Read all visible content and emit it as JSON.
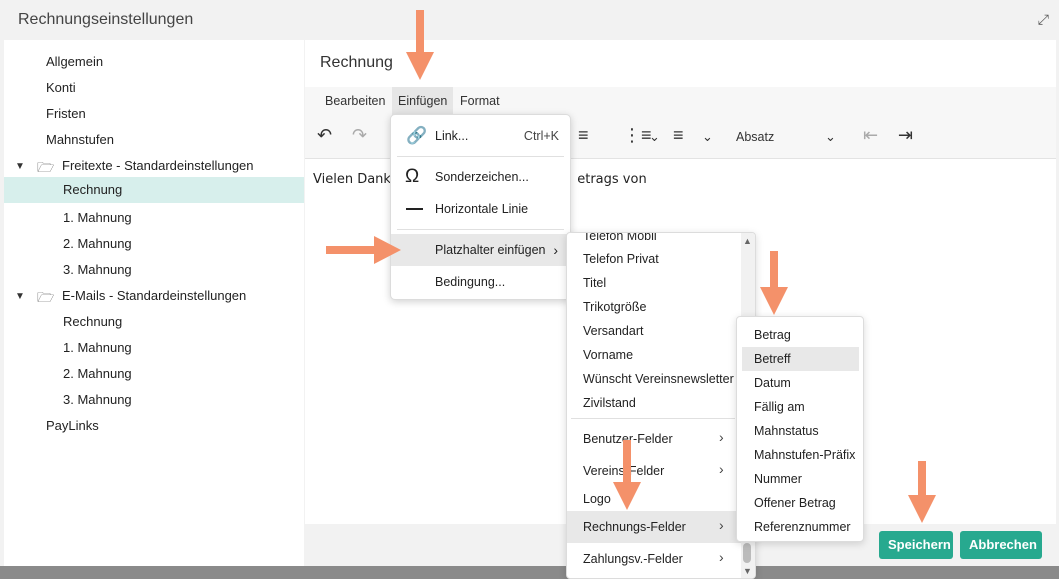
{
  "window": {
    "title": "Rechnungseinstellungen"
  },
  "sidebar": {
    "items": [
      {
        "label": "Allgemein"
      },
      {
        "label": "Konti"
      },
      {
        "label": "Fristen"
      },
      {
        "label": "Mahnstufen"
      },
      {
        "label": "Freitexte - Standardeinstellungen"
      },
      {
        "label": "Rechnung"
      },
      {
        "label": "1. Mahnung"
      },
      {
        "label": "2. Mahnung"
      },
      {
        "label": "3. Mahnung"
      },
      {
        "label": "E-Mails - Standardeinstellungen"
      },
      {
        "label": "Rechnung"
      },
      {
        "label": "1. Mahnung"
      },
      {
        "label": "2. Mahnung"
      },
      {
        "label": "3. Mahnung"
      },
      {
        "label": "PayLinks"
      }
    ]
  },
  "editor": {
    "title": "Rechnung",
    "menus": [
      "Bearbeiten",
      "Einfügen",
      "Format"
    ],
    "block_format": "Absatz",
    "text_left": "Vielen Dank",
    "text_right": "etrags von"
  },
  "insert_menu": {
    "link": {
      "label": "Link...",
      "shortcut": "Ctrl+K"
    },
    "special_chars": "Sonderzeichen...",
    "horizontal_line": "Horizontale Linie",
    "placeholder": "Platzhalter einfügen",
    "condition": "Bedingung..."
  },
  "placeholder_menu": {
    "items": [
      "Telefon Mobil",
      "Telefon Privat",
      "Titel",
      "Trikotgröße",
      "Versandart",
      "Vorname",
      "Wünscht Vereinsnewsletter",
      "Zivilstand"
    ],
    "groups": [
      "Benutzer-Felder",
      "Vereins-Felder",
      "Logo",
      "Rechnungs-Felder",
      "Zahlungsv.-Felder"
    ]
  },
  "invoice_fields": {
    "items": [
      "Betrag",
      "Betreff",
      "Datum",
      "Fällig am",
      "Mahnstatus",
      "Mahnstufen-Präfix",
      "Nummer",
      "Offener Betrag",
      "Referenznummer"
    ]
  },
  "footer": {
    "save": "Speichern",
    "cancel": "Abbrechen"
  },
  "colors": {
    "accent": "#27a98f",
    "annotation_arrow": "#f4916a",
    "selected_row": "#d7efec"
  }
}
